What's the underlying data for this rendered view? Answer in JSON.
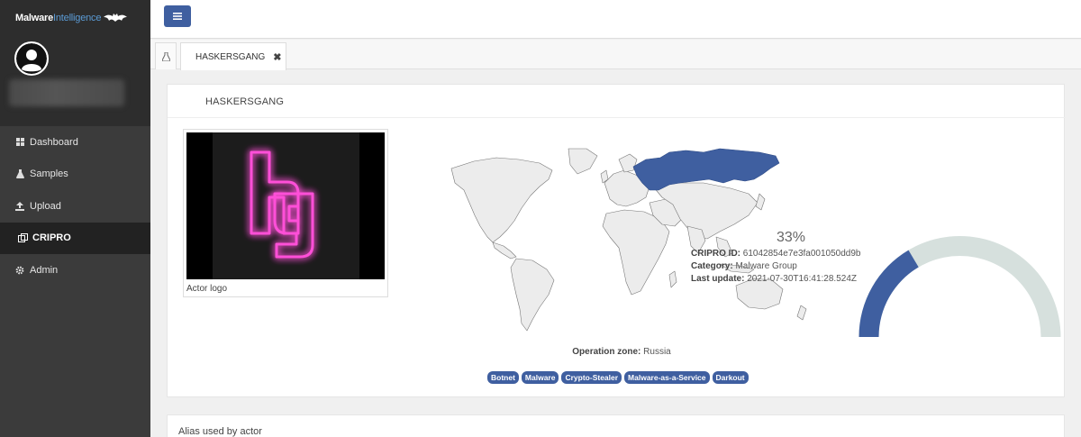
{
  "brand": {
    "part1": "Malware",
    "part2": "Intelligence"
  },
  "sidebar": {
    "items": [
      {
        "label": "Dashboard",
        "icon": "dashboard-icon"
      },
      {
        "label": "Samples",
        "icon": "flask-icon"
      },
      {
        "label": "Upload",
        "icon": "upload-icon"
      },
      {
        "label": "CRIPRO",
        "icon": "cripro-icon",
        "active": true
      },
      {
        "label": "Admin",
        "icon": "gear-icon"
      }
    ]
  },
  "tabs": {
    "active_label": "HASKERSGANG",
    "close": "✖"
  },
  "card": {
    "title": "HASKERSGANG",
    "logo_caption": "Actor logo",
    "logo_text": "hg",
    "operation_zone_label": "Operation zone:",
    "operation_zone_value": "Russia",
    "tags": [
      "Botnet",
      "Malware",
      "Crypto-Stealer",
      "Malware-as-a-Service",
      "Darkout"
    ],
    "gauge": {
      "value": 0.33,
      "display": "33%"
    },
    "cripro_id_label": "CRIPRO ID:",
    "cripro_id_value": "61042854e7e3fa001050dd9b",
    "category_label": "Category:",
    "category_value": "Malware Group",
    "last_update_label": "Last update:",
    "last_update_value": "2021-07-30T16:41:28.524Z"
  },
  "alias_section": {
    "title": "Alias used by actor"
  },
  "colors": {
    "accent": "#3f5fa0",
    "highlight_country": "#3f5fa0",
    "gauge_bg": "#d6e0dd",
    "sidebar": "#3b3b3b"
  }
}
